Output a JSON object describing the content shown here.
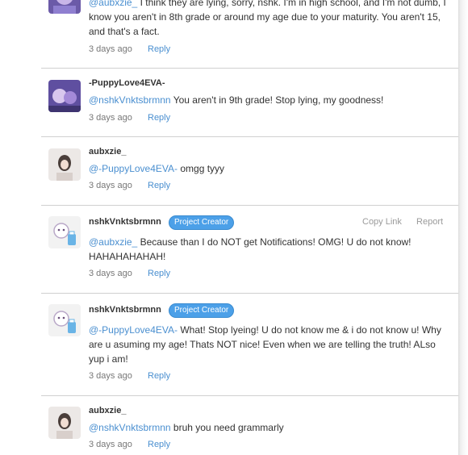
{
  "comments": [
    {
      "author": "",
      "mention": "@aubxzie_",
      "body": "I think they are lying, sorry, nshk. I'm in high school, and I'm not dumb, I know you aren't in 8th grade or around my age due to your maturity. You aren't 15, and that's a fact.",
      "time": "3 days ago",
      "reply": "Reply"
    },
    {
      "author": "-PuppyLove4EVA-",
      "mention": "@nshkVnktsbrmnn",
      "body": "You aren't in 9th grade! Stop lying, my goodness!",
      "time": "3 days ago",
      "reply": "Reply"
    },
    {
      "author": "aubxzie_",
      "mention": "@-PuppyLove4EVA-",
      "body": "omgg tyyy",
      "time": "3 days ago",
      "reply": "Reply"
    },
    {
      "author": "nshkVnktsbrmnn",
      "badge": "Project Creator",
      "copy_link": "Copy Link",
      "report": "Report",
      "mention": "@aubxzie_",
      "body": "Because than I do NOT get Notifications! OMG! U do not know! HAHAHAHAHAH!",
      "time": "3 days ago",
      "reply": "Reply"
    },
    {
      "author": "nshkVnktsbrmnn",
      "badge": "Project Creator",
      "mention": "@-PuppyLove4EVA-",
      "body": "What! Stop lyeing! U do not know me & i do not know u! Why are u asuming my age! Thats NOT nice! Even when we are telling the truth! ALso yup i am!",
      "time": "3 days ago",
      "reply": "Reply"
    },
    {
      "author": "aubxzie_",
      "mention": "@nshkVnktsbrmnn",
      "body": "bruh you need grammarly",
      "time": "3 days ago",
      "reply": "Reply"
    }
  ],
  "colors": {
    "link": "#4a8fd0",
    "badge": "#4ca0e8",
    "text": "#323232",
    "muted": "#777777"
  }
}
